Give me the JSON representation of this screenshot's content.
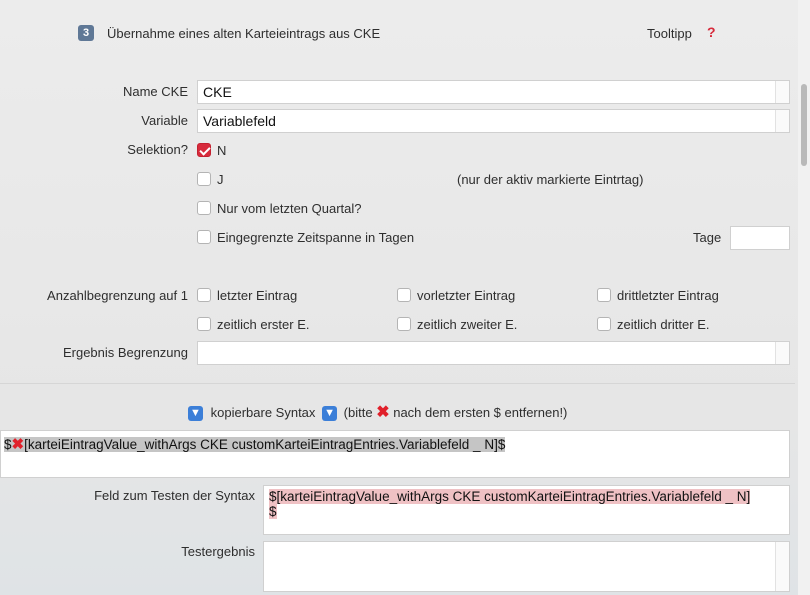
{
  "header": {
    "step_number": "3",
    "title": "Übernahme eines alten Karteieintrags aus CKE",
    "tooltip_label": "Tooltipp",
    "help_glyph": "?"
  },
  "form": {
    "name_cke": {
      "label": "Name CKE",
      "value": "CKE"
    },
    "variable": {
      "label": "Variable",
      "value": "Variablefeld"
    },
    "selektion": {
      "label": "Selektion?",
      "options": [
        {
          "label": "N",
          "checked": true
        },
        {
          "label": "J",
          "checked": false,
          "note": "(nur der aktiv markierte Eintrtag)"
        },
        {
          "label": "Nur vom letzten Quartal?",
          "checked": false
        },
        {
          "label": "Eingegrenzte Zeitspanne in Tagen",
          "checked": false
        }
      ],
      "tage_label": "Tage",
      "tage_value": ""
    },
    "anzahl": {
      "label": "Anzahlbegrenzung auf 1",
      "options": [
        "letzter Eintrag",
        "vorletzter Eintrag",
        "drittletzter Eintrag",
        "zeitlich erster E.",
        "zeitlich zweiter E.",
        "zeitlich dritter E."
      ]
    },
    "ergebnis": {
      "label": "Ergebnis Begrenzung",
      "value": ""
    }
  },
  "syntax": {
    "header_label": "kopierbare Syntax",
    "hint_before": "(bitte",
    "hint_after": "nach dem ersten $ entfernen!)",
    "code_prefix": "$",
    "code_body": "[karteiEintragValue_withArgs CKE customKarteiEintragEntries.Variablefeld _ N]$",
    "test_label": "Feld zum Testen der Syntax",
    "test_line1": "$[karteiEintragValue_withArgs CKE customKarteiEintragEntries.Variablefeld _ N]",
    "test_line2": "$",
    "result_label": "Testergebnis",
    "result_value": ""
  },
  "icons": {
    "step_badge": "number-3-badge-icon",
    "help": "question-mark-icon",
    "arrow": "down-arrow-icon",
    "remove": "red-x-icon"
  },
  "colors": {
    "accent_red": "#d72b3c",
    "badge": "#5f7896",
    "arrow_blue": "#3c7fd8"
  }
}
